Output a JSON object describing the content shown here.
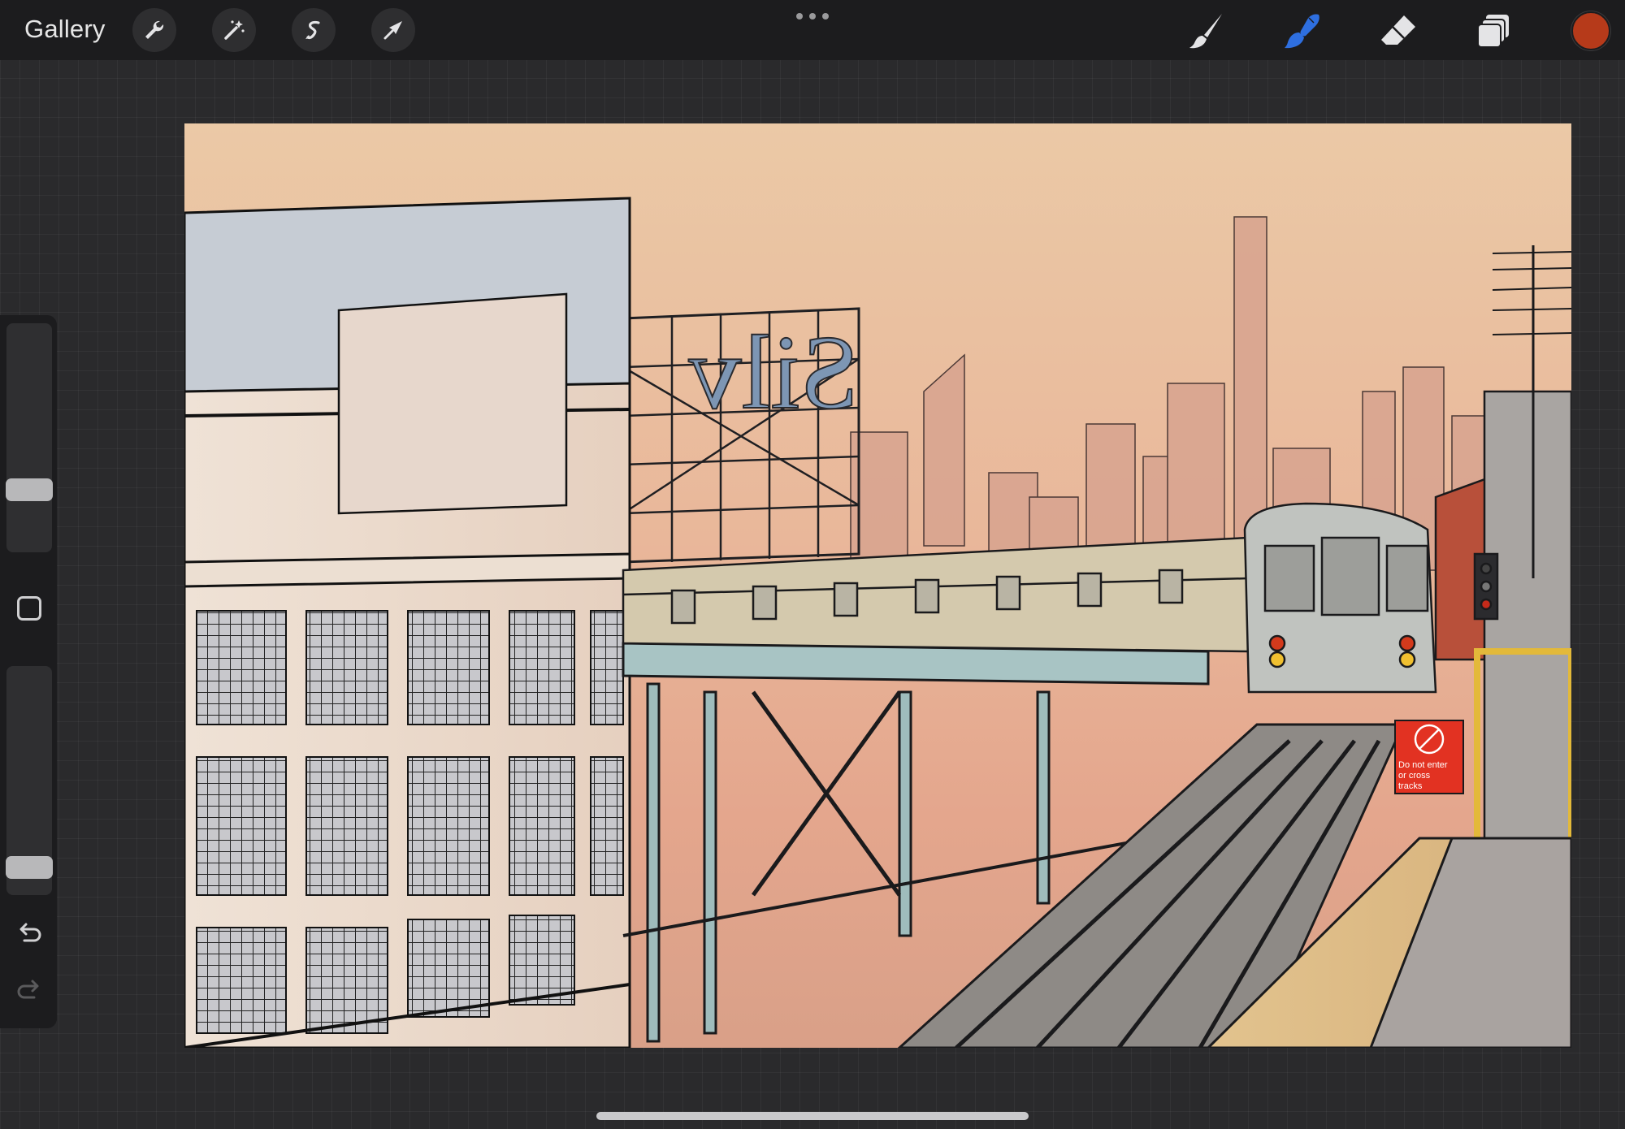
{
  "topbar": {
    "gallery_label": "Gallery",
    "left_tools": [
      "wrench-icon",
      "magic-wand-icon",
      "selection-icon",
      "transform-arrow-icon"
    ],
    "right_tools": [
      "brush-icon",
      "smudge-icon",
      "eraser-icon",
      "layers-icon"
    ],
    "active_tool": "smudge-icon",
    "active_color": "#b63a1a",
    "active_tool_color": "#2e6fe0"
  },
  "sidebar": {
    "brush_size_level": 0.75,
    "opacity_level": 0.92
  },
  "canvas": {
    "sign_text_line1": "Do not enter",
    "sign_text_line2": "or cross",
    "sign_text_line3": "tracks"
  }
}
